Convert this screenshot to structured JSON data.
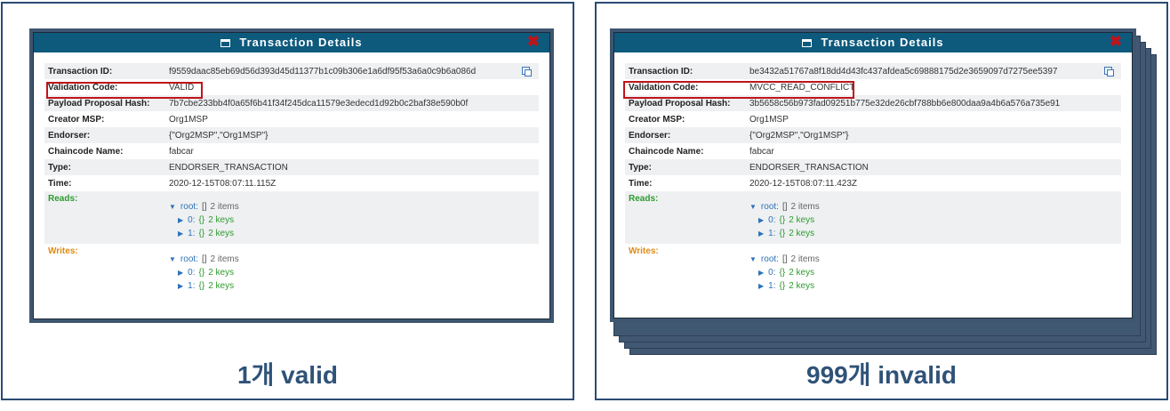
{
  "modal_title": "Transaction Details",
  "labels": {
    "transaction_id": "Transaction ID:",
    "validation_code": "Validation Code:",
    "payload_hash": "Payload Proposal Hash:",
    "creator_msp": "Creator MSP:",
    "endorser": "Endorser:",
    "chaincode_name": "Chaincode Name:",
    "type": "Type:",
    "time": "Time:",
    "reads": "Reads:",
    "writes": "Writes:"
  },
  "tree": {
    "root_key": "root:",
    "root_brackets": "[]",
    "root_count": "2 items",
    "item0_key": "0:",
    "item1_key": "1:",
    "item_brackets": "{}",
    "item_count": "2 keys"
  },
  "left": {
    "caption": "1개 valid",
    "transaction_id": "f9559daac85eb69d56d393d45d11377b1c09b306e1a6df95f53a6a0c9b6a086d",
    "validation_code": "VALID",
    "payload_hash": "7b7cbe233bb4f0a65f6b41f34f245dca11579e3edecd1d92b0c2baf38e590b0f",
    "creator_msp": "Org1MSP",
    "endorser": "{\"Org2MSP\",\"Org1MSP\"}",
    "chaincode_name": "fabcar",
    "type": "ENDORSER_TRANSACTION",
    "time": "2020-12-15T08:07:11.115Z"
  },
  "right": {
    "caption": "999개 invalid",
    "transaction_id": "be3432a51767a8f18dd4d43fc437afdea5c69888175d2e3659097d7275ee5397",
    "validation_code": "MVCC_READ_CONFLICT",
    "payload_hash": "3b5658c56b973fad09251b775e32de26cbf788bb6e800daa9a4b6a576a735e91",
    "creator_msp": "Org1MSP",
    "endorser": "{\"Org2MSP\",\"Org1MSP\"}",
    "chaincode_name": "fabcar",
    "type": "ENDORSER_TRANSACTION",
    "time": "2020-12-15T08:07:11.423Z"
  },
  "colors": {
    "title_bar": "#0d5a7d",
    "highlight": "#c0141a",
    "caption": "#2f5278",
    "reads": "#2e9b2e",
    "writes": "#e08a12"
  },
  "icons": [
    "list-icon",
    "close-icon",
    "copy-icon",
    "expand-arrow-icon"
  ]
}
